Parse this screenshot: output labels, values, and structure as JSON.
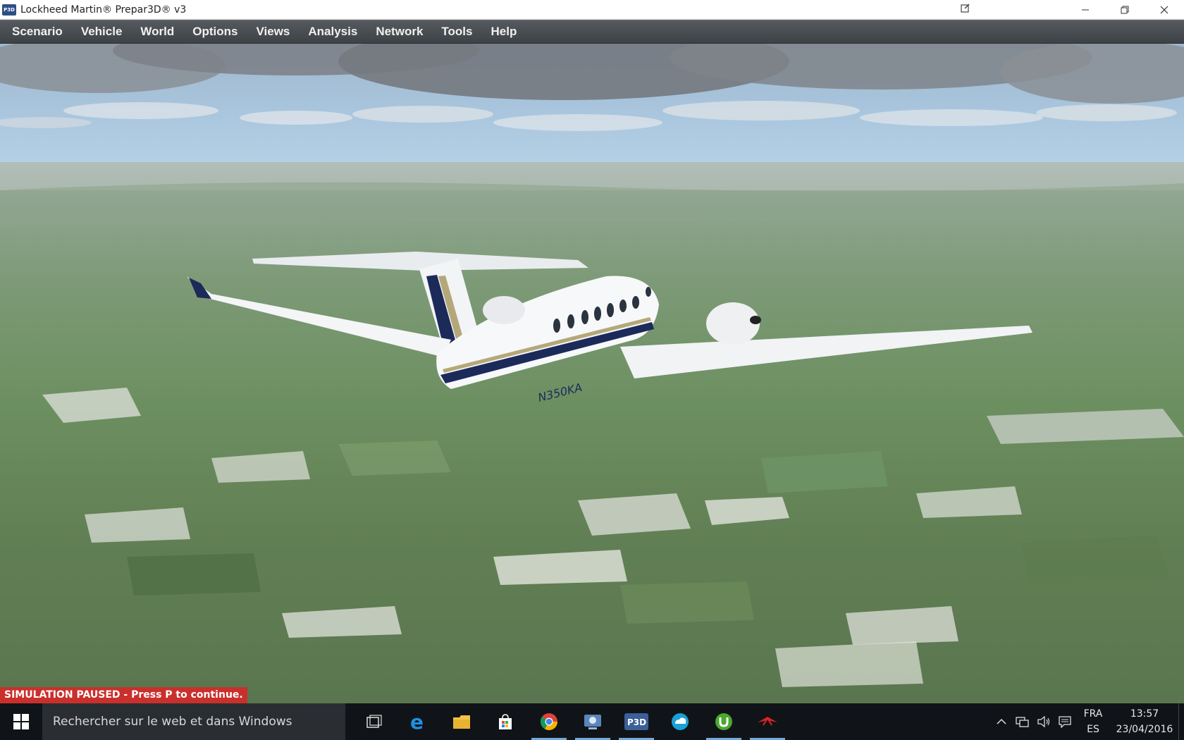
{
  "window": {
    "title": "Lockheed Martin® Prepar3D® v3",
    "app_icon_label": "P3D"
  },
  "menu": [
    {
      "first": "S",
      "rest": "cenario"
    },
    {
      "first": "Ve",
      "underline": "h",
      "rest_after": "icle"
    },
    {
      "first": "W",
      "rest": "orld"
    },
    {
      "first": "O",
      "rest": "ptions"
    },
    {
      "first": "V",
      "rest": "iews"
    },
    {
      "first": "A",
      "rest": "nalysis"
    },
    {
      "first": "N",
      "rest": "etwork"
    },
    {
      "first": "T",
      "rest": "ools"
    },
    {
      "first": "H",
      "rest": "elp"
    }
  ],
  "menu_labels": [
    "Scenario",
    "Vehicle",
    "World",
    "Options",
    "Views",
    "Analysis",
    "Network",
    "Tools",
    "Help"
  ],
  "scene": {
    "aircraft_registration": "N350KA",
    "status_message": "SIMULATION PAUSED - Press P to continue."
  },
  "taskbar": {
    "search_placeholder": "Rechercher sur le web et dans Windows",
    "apps": [
      "task-view",
      "edge",
      "file-explorer",
      "store",
      "chrome",
      "media-app",
      "p3d",
      "weather-app",
      "utorrent",
      "red-app"
    ],
    "language_top": "FRA",
    "language_bottom": "ES",
    "time": "13:57",
    "date": "23/04/2016"
  }
}
